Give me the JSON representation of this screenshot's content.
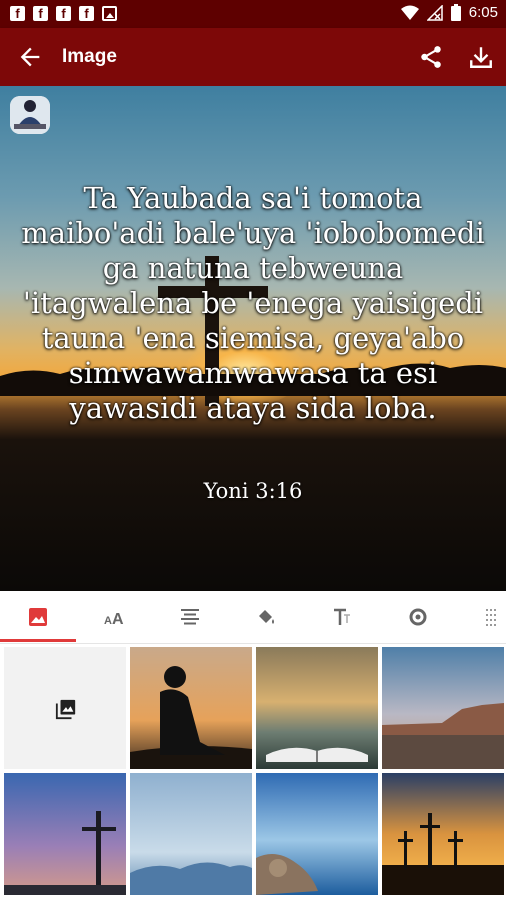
{
  "status_bar": {
    "time": "6:05"
  },
  "app_bar": {
    "title": "Image"
  },
  "verse": {
    "text": "Ta Yaubada sa'i tomota maibo'adi bale'uya 'iobobomedi ga natuna tebweuna 'itagwalena be 'enega yaisigedi tauna 'ena siemisa, geya'abo simwawamwawasa ta esi yawasidi ataya sida loba.",
    "reference": "Yoni 3:16"
  },
  "toolbar": {
    "tabs": [
      "image-icon",
      "font-size-icon",
      "align-icon",
      "paint-bucket-icon",
      "text-style-icon",
      "settings-icon",
      "texture-icon"
    ],
    "selected_tab": 0
  },
  "backgrounds": [
    {
      "name": "gallery",
      "icon": "photo-library-icon"
    },
    {
      "name": "reading-child-sunset"
    },
    {
      "name": "bible-lake"
    },
    {
      "name": "desert-dusk"
    },
    {
      "name": "cross-purple-sky"
    },
    {
      "name": "blue-hills"
    },
    {
      "name": "rocky-shore"
    },
    {
      "name": "three-crosses-sunset"
    }
  ],
  "colors": {
    "status_bar": "#5e0000",
    "app_bar": "#7d0808",
    "accent": "#e03a3a"
  }
}
